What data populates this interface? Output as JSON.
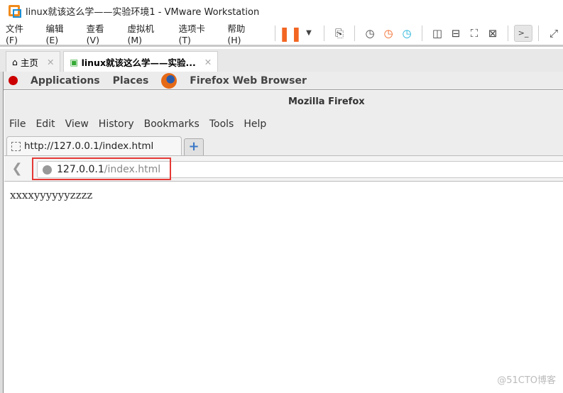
{
  "window": {
    "title": "linux就该这么学——实验环境1 - VMware Workstation"
  },
  "menu": [
    "文件(F)",
    "编辑(E)",
    "查看(V)",
    "虚拟机(M)",
    "选项卡(T)",
    "帮助(H)"
  ],
  "toolbar": [
    "pause-icon",
    "dropdown-icon",
    "send-keys-icon",
    "snapshot-icon",
    "revert-snapshot-icon",
    "snapshot-manager-icon",
    "sidebar-icon",
    "thumbnail-bar-icon",
    "fullscreen-icon",
    "unity-icon",
    "console-icon",
    "stretch-icon"
  ],
  "vm_tabs": [
    {
      "label": "主页"
    },
    {
      "label": "linux就该这么学——实验..."
    }
  ],
  "gnome": {
    "applications": "Applications",
    "places": "Places",
    "app": "Firefox Web Browser"
  },
  "firefox": {
    "title": "Mozilla Firefox",
    "menu": [
      "File",
      "Edit",
      "View",
      "History",
      "Bookmarks",
      "Tools",
      "Help"
    ],
    "tab": "http://127.0.0.1/index.html",
    "new_tab": "+",
    "url_host": "127.0.0.1",
    "url_path": "/index.html",
    "content": "xxxxyyyyyyzzzz"
  },
  "watermark": "@51CTO博客",
  "colors": {
    "highlight": "#e53935",
    "pause": "#f26522"
  }
}
